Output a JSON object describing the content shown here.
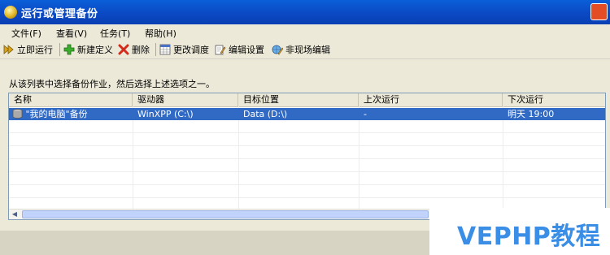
{
  "window": {
    "title": "运行或管理备份"
  },
  "menu": [
    "文件(F)",
    "查看(V)",
    "任务(T)",
    "帮助(H)"
  ],
  "toolbar": {
    "run_now": "立即运行",
    "new_definition": "新建定义",
    "delete": "删除",
    "change_schedule": "更改调度",
    "edit_settings": "编辑设置",
    "offsite_edit": "非现场编辑"
  },
  "instruction": "从该列表中选择备份作业，然后选择上述选项之一。",
  "list": {
    "columns": [
      "名称",
      "驱动器",
      "目标位置",
      "上次运行",
      "下次运行"
    ],
    "rows": [
      {
        "name": "\"我的电脑\"备份",
        "drive": "WinXPP (C:\\)",
        "target": "Data (D:\\)",
        "last_run": "-",
        "next_run": "明天 19:00"
      }
    ]
  },
  "watermark": "VEPHP教程",
  "colors": {
    "title_bar": "#0b49c4",
    "selection": "#316ac5",
    "watermark": "#3b8ee6"
  }
}
